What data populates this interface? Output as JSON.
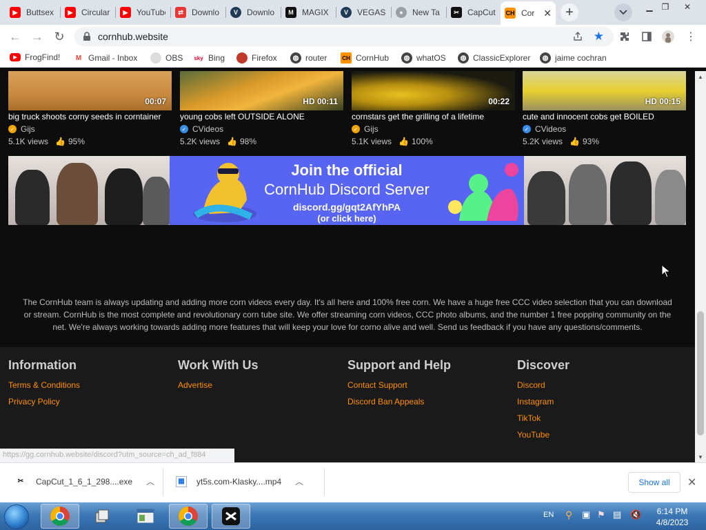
{
  "browser": {
    "tabs": [
      {
        "label": "Buttsex",
        "icon": "youtube-icon"
      },
      {
        "label": "Circular",
        "icon": "youtube-icon"
      },
      {
        "label": "YouTube",
        "icon": "youtube-icon"
      },
      {
        "label": "Downlo",
        "icon": "download-site-icon"
      },
      {
        "label": "Downlo",
        "icon": "vegas-icon"
      },
      {
        "label": "MAGIX",
        "icon": "magix-icon"
      },
      {
        "label": "VEGAS",
        "icon": "vegas-icon"
      },
      {
        "label": "New Ta",
        "icon": "chrome-icon"
      },
      {
        "label": "CapCut",
        "icon": "capcut-icon"
      },
      {
        "label": "Cor",
        "icon": "cornhub-icon",
        "active": true
      }
    ],
    "url": "cornhub.website",
    "bookmarks": [
      {
        "label": "FrogFind!",
        "icon": "youtube-icon"
      },
      {
        "label": "Gmail - Inbox",
        "icon": "gmail-icon"
      },
      {
        "label": "OBS",
        "icon": "obs-icon"
      },
      {
        "label": "Bing",
        "icon": "sky-icon"
      },
      {
        "label": "Firefox",
        "icon": "firefox-icon"
      },
      {
        "label": "router",
        "icon": "globe-icon"
      },
      {
        "label": "CornHub",
        "icon": "cornhub-icon"
      },
      {
        "label": "whatOS",
        "icon": "globe-icon"
      },
      {
        "label": "ClassicExplorer",
        "icon": "globe-icon"
      },
      {
        "label": "jaime cochran",
        "icon": "globe-icon"
      }
    ],
    "status_url": "https://gg.cornhub.website/discord?utm_source=ch_ad_f884"
  },
  "videos": [
    {
      "title": "big truck shoots corny seeds in corntainer",
      "channel": "Gijs",
      "verified_color": "#f0a500",
      "views": "5.1K views",
      "rating": "95%",
      "duration": "00:07"
    },
    {
      "title": "young cobs left OUTSIDE ALONE",
      "channel": "CVideos",
      "verified_color": "#3a8ee6",
      "views": "5.2K views",
      "rating": "98%",
      "duration": "HD 00:11"
    },
    {
      "title": "cornstars get the grilling of a lifetime",
      "channel": "Gijs",
      "verified_color": "#f0a500",
      "views": "5.1K views",
      "rating": "100%",
      "duration": "00:22"
    },
    {
      "title": "cute and innocent cobs get BOILED",
      "channel": "CVideos",
      "verified_color": "#3a8ee6",
      "views": "5.2K views",
      "rating": "93%",
      "duration": "HD 00:15"
    }
  ],
  "banner": {
    "line1": "Join the official",
    "line2": "CornHub Discord Server",
    "line3": "discord.gg/gqt2AfYhPA",
    "line4": "(or click here)"
  },
  "about": "The CornHub team is always updating and adding more corn videos every day. It's all here and 100% free corn. We have a huge free CCC video selection that you can download or stream. CornHub is the most complete and revolutionary corn tube site. We offer streaming corn videos, CCC photo albums, and the number 1 free popping community on the net. We're always working towards adding more features that will keep your love for corno alive and well. Send us feedback if you have any questions/comments.",
  "footer": {
    "columns": [
      {
        "heading": "Information",
        "links": [
          "Terms & Conditions",
          "Privacy Policy"
        ]
      },
      {
        "heading": "Work With Us",
        "links": [
          "Advertise"
        ]
      },
      {
        "heading": "Support and Help",
        "links": [
          "Contact Support",
          "Discord Ban Appeals"
        ]
      },
      {
        "heading": "Discover",
        "links": [
          "Discord",
          "Instagram",
          "TikTok",
          "YouTube"
        ]
      }
    ]
  },
  "downloads": {
    "items": [
      {
        "name": "CapCut_1_6_1_298....exe",
        "icon": "capcut-icon"
      },
      {
        "name": "yt5s.com-Klasky....mp4",
        "icon": "video-file-icon"
      }
    ],
    "show_all": "Show all"
  },
  "taskbar": {
    "language": "EN",
    "time": "6:14 PM",
    "date": "4/8/2023"
  },
  "colors": {
    "link": "#ff9000",
    "discord": "#5865f2",
    "page_bg": "#0d0d0d",
    "footer_bg": "#1a1a1a"
  }
}
